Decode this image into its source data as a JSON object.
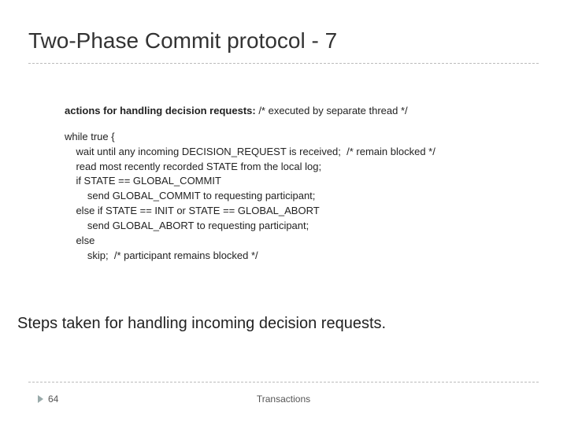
{
  "title": "Two-Phase Commit protocol - 7",
  "actions": {
    "label": "actions for handling decision requests:",
    "comment": " /* executed by separate thread */"
  },
  "code": "while true {\n    wait until any incoming DECISION_REQUEST is received;  /* remain blocked */\n    read most recently recorded STATE from the local log;\n    if STATE == GLOBAL_COMMIT\n        send GLOBAL_COMMIT to requesting participant;\n    else if STATE == INIT or STATE == GLOBAL_ABORT\n        send GLOBAL_ABORT to requesting participant;\n    else\n        skip;  /* participant remains blocked */",
  "steps": "Steps taken for handling incoming decision requests.",
  "page_number": "64",
  "footer": "Transactions"
}
